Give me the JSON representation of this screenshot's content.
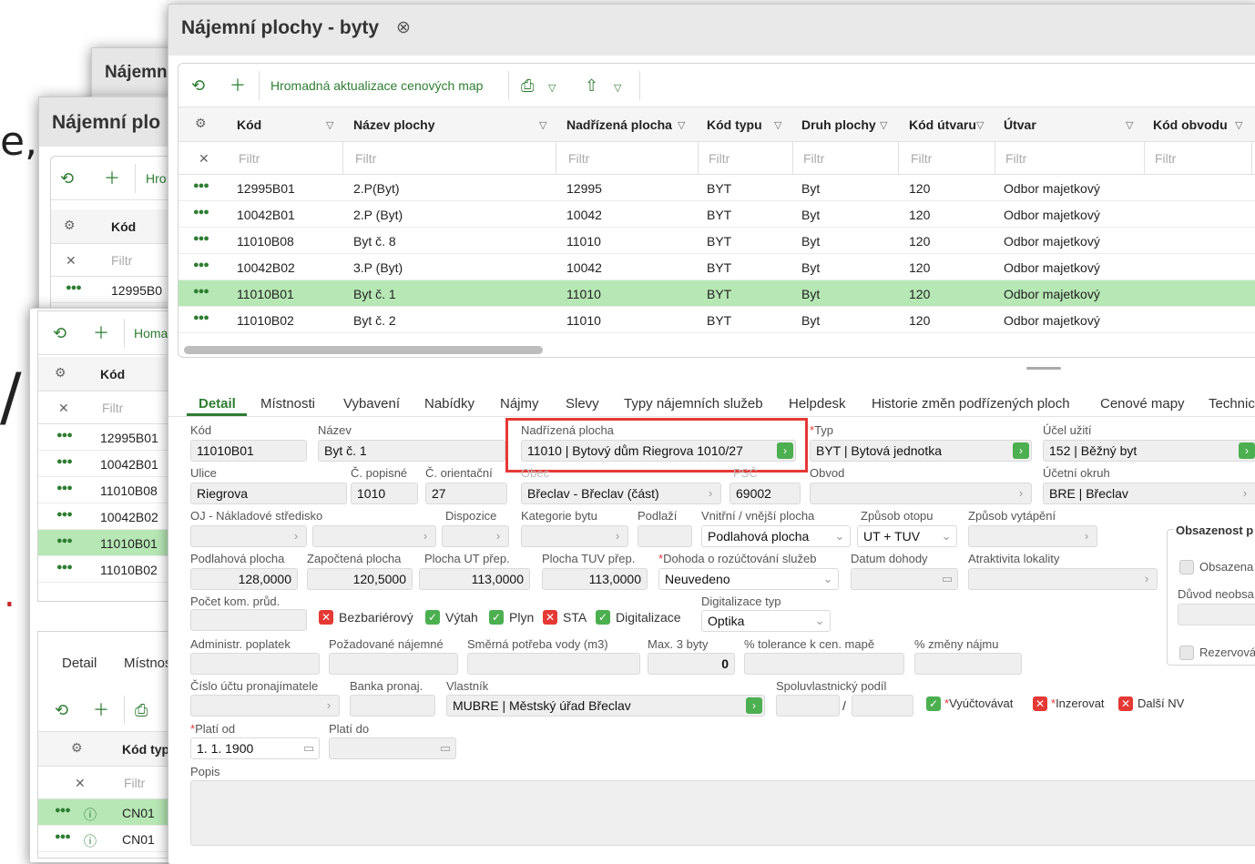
{
  "bg_chars": [
    "e,",
    "/",
    "."
  ],
  "back_windows": {
    "win1_title": "Nájemn",
    "win2_title": "Nájemní plo",
    "toolbar_hrom_short": "Hro",
    "toolbar_hrom_short2": "Homa",
    "col_kod": "Kód",
    "filtr": "Filtr",
    "row_first": "12995B0",
    "rows_win3": [
      "12995B01",
      "10042B01",
      "11010B08",
      "10042B02",
      "11010B01",
      "11010B02"
    ],
    "tab_detail": "Detail",
    "tab_mistnos": "Místnos",
    "sub_col": "Kód typu",
    "sub_rows": [
      "CN01",
      "CN01"
    ]
  },
  "window": {
    "title": "Nájemní plochy - byty",
    "close_icon": "⊗"
  },
  "toolbar": {
    "bulk_update": "Hromadná aktualizace cenových map"
  },
  "grid": {
    "columns": [
      "Kód",
      "Název plochy",
      "Nadřízená plocha",
      "Kód typu",
      "Druh plochy",
      "Kód útvaru",
      "Útvar",
      "Kód obvodu"
    ],
    "filter_placeholder": "Filtr",
    "rows": [
      [
        "12995B01",
        "2.P(Byt)",
        "12995",
        "BYT",
        "Byt",
        "120",
        "Odbor majetkový"
      ],
      [
        "10042B01",
        "2.P (Byt)",
        "10042",
        "BYT",
        "Byt",
        "120",
        "Odbor majetkový"
      ],
      [
        "11010B08",
        "Byt č. 8",
        "11010",
        "BYT",
        "Byt",
        "120",
        "Odbor majetkový"
      ],
      [
        "10042B02",
        "3.P (Byt)",
        "10042",
        "BYT",
        "Byt",
        "120",
        "Odbor majetkový"
      ],
      [
        "11010B01",
        "Byt č. 1",
        "11010",
        "BYT",
        "Byt",
        "120",
        "Odbor majetkový"
      ],
      [
        "11010B02",
        "Byt č. 2",
        "11010",
        "BYT",
        "Byt",
        "120",
        "Odbor majetkový"
      ]
    ],
    "selected_row": 4
  },
  "tabs": [
    "Detail",
    "Místnosti",
    "Vybavení",
    "Nabídky",
    "Nájmy",
    "Slevy",
    "Typy nájemních služeb",
    "Helpdesk",
    "Historie změn podřízených ploch",
    "Cenové mapy",
    "Technic"
  ],
  "form": {
    "kod_l": "Kód",
    "kod_v": "11010B01",
    "nazev_l": "Název",
    "nazev_v": "Byt č. 1",
    "nadrizena_l": "Nadřízená plocha",
    "nadrizena_v": "11010 | Bytový dům Riegrova 1010/27",
    "typ_l": "Typ",
    "typ_v": "BYT | Bytová jednotka",
    "ucel_l": "Účel užití",
    "ucel_v": "152 | Běžný byt",
    "ulice_l": "Ulice",
    "ulice_v": "Riegrova",
    "cpopisne_l": "Č. popisné",
    "cpopisne_v": "1010",
    "corientacni_l": "Č. orientační",
    "corientacni_v": "27",
    "obec_l": "Obec",
    "obec_v": "Břeclav - Břeclav (část)",
    "psc_l": "PSČ",
    "psc_v": "69002",
    "obvod_l": "Obvod",
    "ucetni_l": "Účetní okruh",
    "ucetni_v": "BRE | Břeclav",
    "oj_l": "OJ - Nákladové středisko",
    "dispozice_l": "Dispozice",
    "kategorie_l": "Kategorie bytu",
    "podlazi_l": "Podlaží",
    "vnitrni_l": "Vnitřní / vnější plocha",
    "vnitrni_v": "Podlahová plocha",
    "otop_l": "Způsob otopu",
    "otop_v": "UT + TUV",
    "vytapeni_l": "Způsob vytápění",
    "obsazenost_title": "Obsazenost p",
    "podlahova_l": "Podlahová plocha",
    "podlahova_v": "128,0000",
    "zapoctena_l": "Započtená plocha",
    "zapoctena_v": "120,5000",
    "ut_l": "Plocha UT přep.",
    "ut_v": "113,0000",
    "tuv_l": "Plocha TUV přep.",
    "tuv_v": "113,0000",
    "dohoda_l": "Dohoda o rozúčtování služeb",
    "dohoda_v": "Neuvedeno",
    "datum_l": "Datum dohody",
    "atraktivita_l": "Atraktivita lokality",
    "obsazena_l": "Obsazena",
    "duvod_l": "Důvod neobsa",
    "pocet_l": "Počet kom. průd.",
    "bezbarier_l": "Bezbariérový",
    "vytah_l": "Výtah",
    "plyn_l": "Plyn",
    "sta_l": "STA",
    "digit_l": "Digitalizace",
    "digtyp_l": "Digitalizace typ",
    "digtyp_v": "Optika",
    "admin_l": "Administr. poplatek",
    "pozad_l": "Požadované nájemné",
    "voda_l": "Směrná potřeba vody (m3)",
    "max3_l": "Max. 3 byty",
    "max3_v": "0",
    "tol_l": "% tolerance k cen. mapě",
    "zmeny_l": "% změny nájmu",
    "rezerv_l": "Rezervová",
    "ucet_l": "Číslo účtu pronajímatele",
    "banka_l": "Banka pronaj.",
    "vlastnik_l": "Vlastník",
    "vlastnik_v": "MUBRE | Městský úřad Břeclav",
    "podil_l": "Spoluvlastnický podíl",
    "podil_sep": "/",
    "vyuct_l": "Vyúčtovávat",
    "inzer_l": "Inzerovat",
    "dalsi_l": "Další NV",
    "platiod_l": "Platí od",
    "platiod_v": "1. 1. 1900",
    "platido_l": "Platí do",
    "popis_l": "Popis"
  },
  "colors": {
    "accent": "#2e7d32",
    "highlight": "#e53935",
    "selected_row": "#b7e7b5"
  }
}
